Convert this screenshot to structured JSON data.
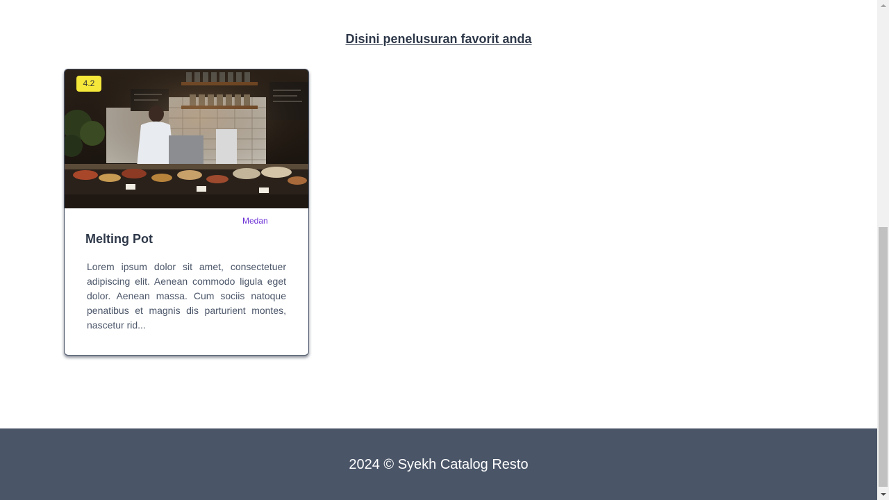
{
  "section": {
    "title": "Disini penelusuran favorit anda"
  },
  "restaurants": [
    {
      "rating": "4.2",
      "city": "Medan",
      "name": "Melting Pot",
      "description": "Lorem ipsum dolor sit amet, consectetuer adipiscing elit. Aenean commodo ligula eget dolor. Aenean massa. Cum sociis natoque penatibus et magnis dis parturient montes, nascetur rid...",
      "image": "restaurant-interior-photo"
    }
  ],
  "footer": {
    "text": "2024 © Syekh Catalog Resto"
  },
  "colors": {
    "footer_bg": "#4a5568",
    "rating_badge": "#f5e83a",
    "city_text": "#6b2fd6",
    "heading_text": "#2d3748"
  },
  "icons": {
    "scroll_up": "scroll-up-arrow-icon",
    "scroll_down": "scroll-down-arrow-icon"
  }
}
